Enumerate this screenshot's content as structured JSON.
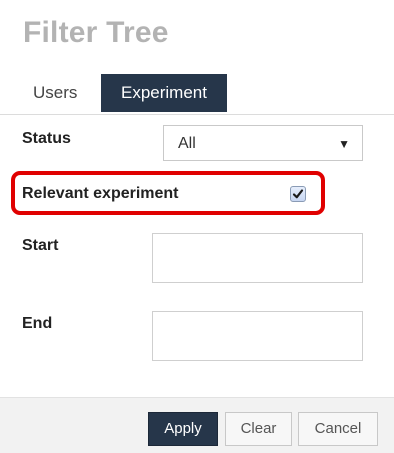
{
  "title": "Filter Tree",
  "tabs": [
    {
      "label": "Users",
      "active": false
    },
    {
      "label": "Experiment",
      "active": true
    }
  ],
  "form": {
    "status": {
      "label": "Status",
      "value": "All"
    },
    "relevant": {
      "label": "Relevant experiment",
      "checked": true
    },
    "start": {
      "label": "Start",
      "value": ""
    },
    "end": {
      "label": "End",
      "value": ""
    }
  },
  "buttons": {
    "apply": "Apply",
    "clear": "Clear",
    "cancel": "Cancel"
  },
  "colors": {
    "accent_dark": "#26364a",
    "highlight_red": "#e00000",
    "title_gray": "#b3b3b3"
  },
  "icons": {
    "select_caret": "chevron-down-icon",
    "checkbox_mark": "checkmark-icon"
  }
}
